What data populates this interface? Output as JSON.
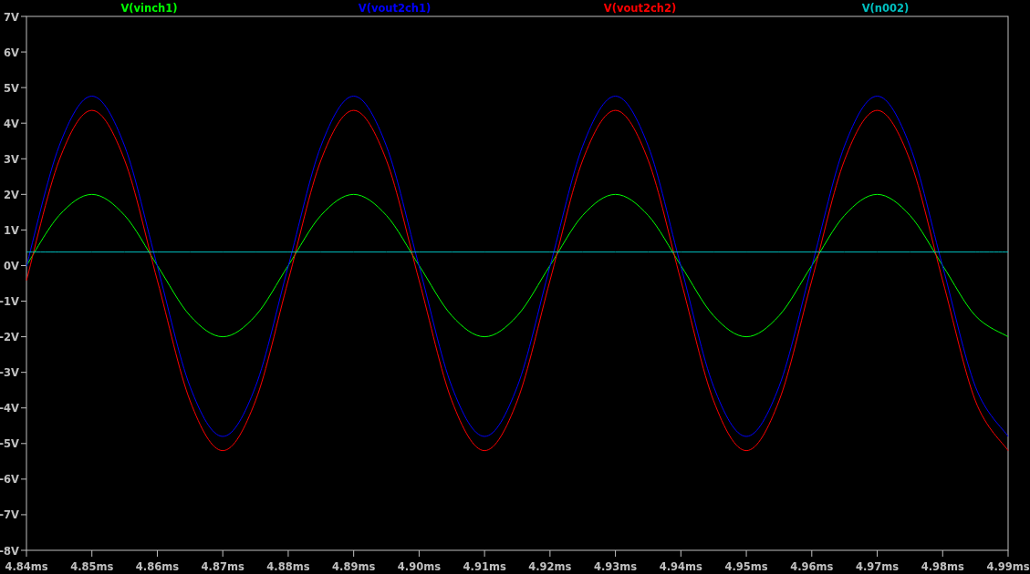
{
  "plot": {
    "chart_data": {
      "type": "line",
      "x": [
        4.84,
        4.845,
        4.85,
        4.855,
        4.86,
        4.865,
        4.87,
        4.875,
        4.88,
        4.885,
        4.89,
        4.895,
        4.9,
        4.905,
        4.91,
        4.915,
        4.92,
        4.925,
        4.93,
        4.935,
        4.94,
        4.945,
        4.95,
        4.955,
        4.96,
        4.965,
        4.97,
        4.975,
        4.98,
        4.985,
        4.99
      ],
      "series": [
        {
          "name": "V(vinch1)",
          "color": "#00ff00",
          "values": [
            0,
            1.41,
            2,
            1.41,
            0,
            -1.41,
            -2,
            -1.41,
            0,
            1.41,
            2,
            1.41,
            0,
            -1.41,
            -2,
            -1.41,
            0,
            1.41,
            2,
            1.41,
            0,
            -1.41,
            -2,
            -1.41,
            0,
            1.41,
            2,
            1.41,
            0,
            -1.41,
            -2
          ]
        },
        {
          "name": "V(vout2ch1)",
          "color": "#0000ff",
          "values": [
            -0.02,
            3.36,
            4.76,
            3.36,
            -0.02,
            -3.4,
            -4.8,
            -3.4,
            -0.02,
            3.36,
            4.76,
            3.36,
            -0.02,
            -3.4,
            -4.8,
            -3.4,
            -0.02,
            3.36,
            4.76,
            3.36,
            -0.02,
            -3.4,
            -4.8,
            -3.4,
            -0.02,
            3.36,
            4.76,
            3.36,
            -0.02,
            -3.4,
            -4.8
          ]
        },
        {
          "name": "V(vout2ch2)",
          "color": "#ff0000",
          "values": [
            -0.42,
            2.96,
            4.36,
            2.96,
            -0.42,
            -3.8,
            -5.2,
            -3.8,
            -0.42,
            2.96,
            4.36,
            2.96,
            -0.42,
            -3.8,
            -5.2,
            -3.8,
            -0.42,
            2.96,
            4.36,
            2.96,
            -0.42,
            -3.8,
            -5.2,
            -3.8,
            -0.42,
            2.96,
            4.36,
            2.96,
            -0.42,
            -3.8,
            -5.2
          ]
        },
        {
          "name": "V(n002)",
          "color": "#00c0c0",
          "values": [
            0.38,
            0.38,
            0.38,
            0.38,
            0.38,
            0.38,
            0.38,
            0.38,
            0.38,
            0.38,
            0.38,
            0.38,
            0.38,
            0.38,
            0.38,
            0.38,
            0.38,
            0.38,
            0.38,
            0.38,
            0.38,
            0.38,
            0.38,
            0.38,
            0.38,
            0.38,
            0.38,
            0.38,
            0.38,
            0.38,
            0.38
          ]
        }
      ],
      "xlim": [
        4.84,
        4.99
      ],
      "ylim": [
        -8,
        7
      ],
      "xticks": [
        {
          "value": 4.84,
          "label": "4.84ms"
        },
        {
          "value": 4.85,
          "label": "4.85ms"
        },
        {
          "value": 4.86,
          "label": "4.86ms"
        },
        {
          "value": 4.87,
          "label": "4.87ms"
        },
        {
          "value": 4.88,
          "label": "4.88ms"
        },
        {
          "value": 4.89,
          "label": "4.89ms"
        },
        {
          "value": 4.9,
          "label": "4.90ms"
        },
        {
          "value": 4.91,
          "label": "4.91ms"
        },
        {
          "value": 4.92,
          "label": "4.92ms"
        },
        {
          "value": 4.93,
          "label": "4.93ms"
        },
        {
          "value": 4.94,
          "label": "4.94ms"
        },
        {
          "value": 4.95,
          "label": "4.95ms"
        },
        {
          "value": 4.96,
          "label": "4.96ms"
        },
        {
          "value": 4.97,
          "label": "4.97ms"
        },
        {
          "value": 4.98,
          "label": "4.98ms"
        },
        {
          "value": 4.99,
          "label": "4.99ms"
        }
      ],
      "yticks": [
        {
          "value": 7,
          "label": "7V"
        },
        {
          "value": 6,
          "label": "6V"
        },
        {
          "value": 5,
          "label": "5V"
        },
        {
          "value": 4,
          "label": "4V"
        },
        {
          "value": 3,
          "label": "3V"
        },
        {
          "value": 2,
          "label": "2V"
        },
        {
          "value": 1,
          "label": "1V"
        },
        {
          "value": 0,
          "label": "0V"
        },
        {
          "value": -1,
          "label": "-1V"
        },
        {
          "value": -2,
          "label": "-2V"
        },
        {
          "value": -3,
          "label": "-3V"
        },
        {
          "value": -4,
          "label": "-4V"
        },
        {
          "value": -5,
          "label": "-5V"
        },
        {
          "value": -6,
          "label": "-6V"
        },
        {
          "value": -7,
          "label": "-7V"
        },
        {
          "value": -8,
          "label": "-8V"
        }
      ]
    }
  }
}
